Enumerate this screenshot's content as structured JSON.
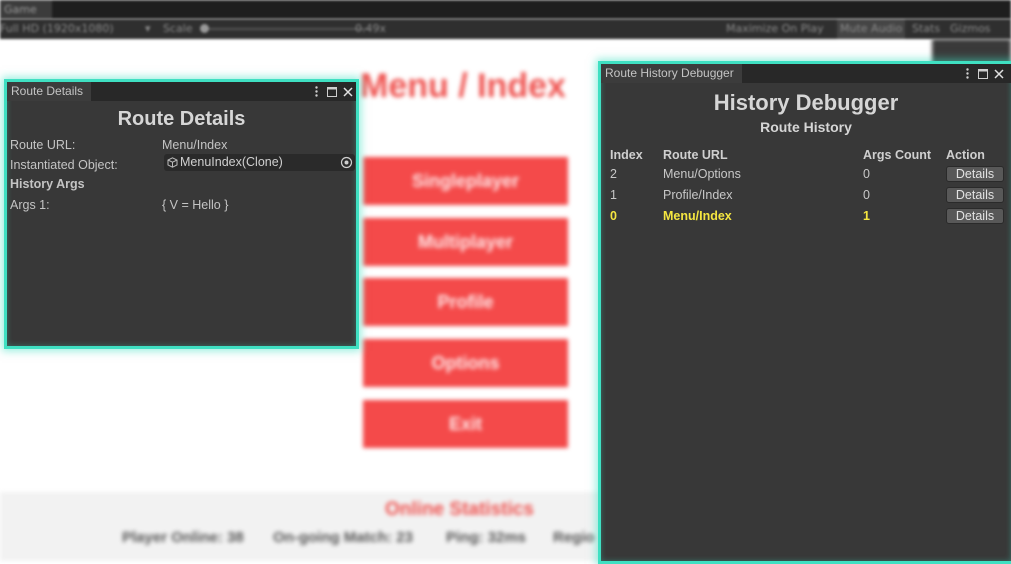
{
  "game_view": {
    "tab_label": "Game",
    "toolbar": {
      "resolution": "Full HD (1920x1080)",
      "scale_label": "Scale",
      "scale_value": "0.49x",
      "maximize_on_play": "Maximize On Play",
      "mute_audio": "Mute Audio",
      "stats": "Stats",
      "gizmos": "Gizmos"
    },
    "menu_title": "Menu / Index",
    "menu_buttons": [
      "Singleplayer",
      "Multiplayer",
      "Profile",
      "Options",
      "Exit"
    ],
    "online_statistics": {
      "title": "Online Statistics",
      "player_online": "Player Online: 38",
      "ongoing_match": "On-going Match: 23",
      "ping": "Ping: 32ms",
      "region": "Regio"
    }
  },
  "route_details": {
    "tab_label": "Route Details",
    "title": "Route Details",
    "route_url_label": "Route URL:",
    "route_url_value": "Menu/Index",
    "instantiated_object_label": "Instantiated Object:",
    "instantiated_object_value": "MenuIndex(Clone)",
    "history_args_label": "History Args",
    "args": [
      {
        "label": "Args 1:",
        "value": "{ V = Hello }"
      }
    ]
  },
  "route_history": {
    "tab_label": "Route History Debugger",
    "title": "History Debugger",
    "subtitle": "Route History",
    "columns": {
      "index": "Index",
      "route_url": "Route URL",
      "args_count": "Args Count",
      "action": "Action"
    },
    "rows": [
      {
        "index": "2",
        "route_url": "Menu/Options",
        "args_count": "0",
        "action": "Details"
      },
      {
        "index": "1",
        "route_url": "Profile/Index",
        "args_count": "0",
        "action": "Details"
      },
      {
        "index": "0",
        "route_url": "Menu/Index",
        "args_count": "1",
        "action": "Details"
      }
    ]
  },
  "colors": {
    "highlight_border": "#3fe0c2",
    "current_row": "#f5e640",
    "menu_red": "#f44a4a",
    "panel_bg": "#383838"
  }
}
